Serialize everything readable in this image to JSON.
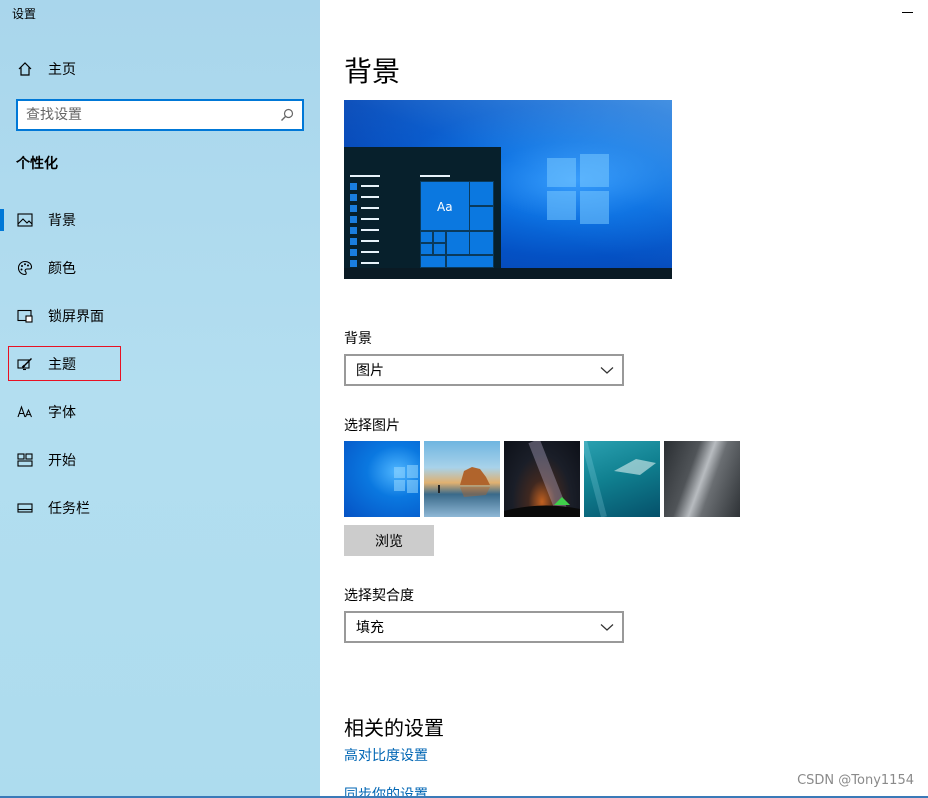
{
  "window": {
    "title": "设置"
  },
  "sidebar": {
    "home_label": "主页",
    "search_placeholder": "查找设置",
    "section_title": "个性化",
    "items": [
      {
        "label": "背景",
        "icon": "picture-icon",
        "active": true
      },
      {
        "label": "颜色",
        "icon": "palette-icon",
        "active": false
      },
      {
        "label": "锁屏界面",
        "icon": "lock-screen-icon",
        "active": false
      },
      {
        "label": "主题",
        "icon": "brush-icon",
        "active": false,
        "highlighted": true
      },
      {
        "label": "字体",
        "icon": "font-icon",
        "active": false
      },
      {
        "label": "开始",
        "icon": "start-icon",
        "active": false
      },
      {
        "label": "任务栏",
        "icon": "taskbar-icon",
        "active": false
      }
    ]
  },
  "main": {
    "page_title": "背景",
    "preview_tile_text": "Aa",
    "background": {
      "label": "背景",
      "value": "图片"
    },
    "choose_picture": {
      "label": "选择图片"
    },
    "browse_label": "浏览",
    "fit": {
      "label": "选择契合度",
      "value": "填充"
    },
    "related": {
      "title": "相关的设置",
      "links": [
        "高对比度设置",
        "同步你的设置"
      ]
    }
  },
  "watermark": "CSDN @Tony1154",
  "colors": {
    "accent": "#0078d7",
    "highlight_border": "#e81123",
    "link": "#0066b4"
  }
}
